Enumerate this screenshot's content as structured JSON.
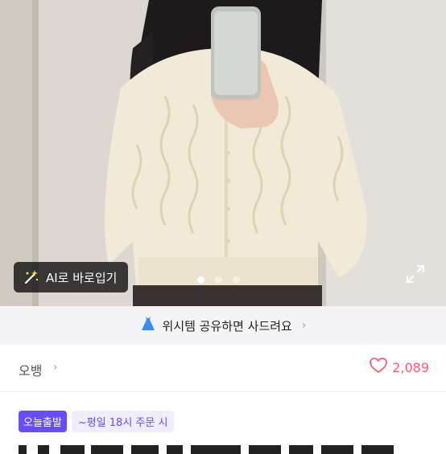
{
  "hero": {
    "ai_button_label": "AI로 바로입기",
    "ai_icon": "magic-wand-icon",
    "expand_icon": "expand-icon",
    "carousel": {
      "count": 3,
      "active_index": 0
    }
  },
  "wish_bar": {
    "icon": "dress-icon",
    "label": "위시템 공유하면 사드려요",
    "chevron": "›"
  },
  "seller": {
    "name": "오뱅",
    "chevron": "›",
    "like_icon": "heart-icon",
    "like_count": "2,089"
  },
  "badges": {
    "primary": "오늘출발",
    "secondary": "~평일 18시 주문 시"
  },
  "colors": {
    "accent": "#6a4cff",
    "like": "#ff5a78",
    "wish_bar_bg": "#f4f4f6"
  }
}
